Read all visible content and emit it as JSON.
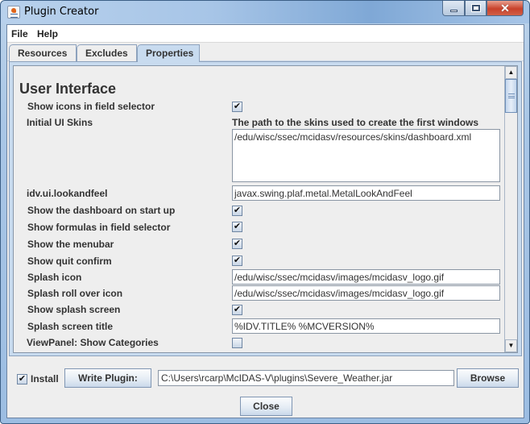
{
  "window": {
    "title": "Plugin Creator",
    "controls": {
      "minimize": "minimize",
      "maximize": "maximize",
      "close": "✕"
    }
  },
  "menubar": {
    "items": [
      "File",
      "Help"
    ]
  },
  "tabs": [
    {
      "label": "Resources",
      "active": false
    },
    {
      "label": "Excludes",
      "active": false
    },
    {
      "label": "Properties",
      "active": true
    }
  ],
  "properties": {
    "section_title": "User Interface",
    "rows": [
      {
        "label": "Show icons in field selector",
        "type": "checkbox",
        "checked": true
      },
      {
        "label": "Initial UI Skins",
        "type": "textarea",
        "hint": "The path to the skins used to create the first windows",
        "value": "/edu/wisc/ssec/mcidasv/resources/skins/dashboard.xml"
      },
      {
        "label": "idv.ui.lookandfeel",
        "type": "text",
        "value": "javax.swing.plaf.metal.MetalLookAndFeel"
      },
      {
        "label": "Show the dashboard on start up",
        "type": "checkbox",
        "checked": true
      },
      {
        "label": "Show formulas in field selector",
        "type": "checkbox",
        "checked": true
      },
      {
        "label": "Show the menubar",
        "type": "checkbox",
        "checked": true
      },
      {
        "label": "Show quit confirm",
        "type": "checkbox",
        "checked": true
      },
      {
        "label": "Splash icon",
        "type": "text",
        "value": "/edu/wisc/ssec/mcidasv/images/mcidasv_logo.gif"
      },
      {
        "label": "Splash roll over icon",
        "type": "text",
        "value": "/edu/wisc/ssec/mcidasv/images/mcidasv_logo.gif"
      },
      {
        "label": "Show splash screen",
        "type": "checkbox",
        "checked": true
      },
      {
        "label": "Splash screen title",
        "type": "text",
        "value": "%IDV.TITLE% %MCVERSION%"
      },
      {
        "label": "ViewPanel: Show Categories",
        "type": "checkbox",
        "checked": false
      }
    ],
    "check_glyph": "✔"
  },
  "scrollbar": {
    "up": "▲",
    "down": "▼"
  },
  "footer": {
    "install_label": "Install",
    "install_checked": true,
    "write_plugin_label": "Write Plugin:",
    "plugin_path": "C:\\Users\\rcarp\\McIDAS-V\\plugins\\Severe_Weather.jar",
    "browse_label": "Browse",
    "close_label": "Close"
  }
}
